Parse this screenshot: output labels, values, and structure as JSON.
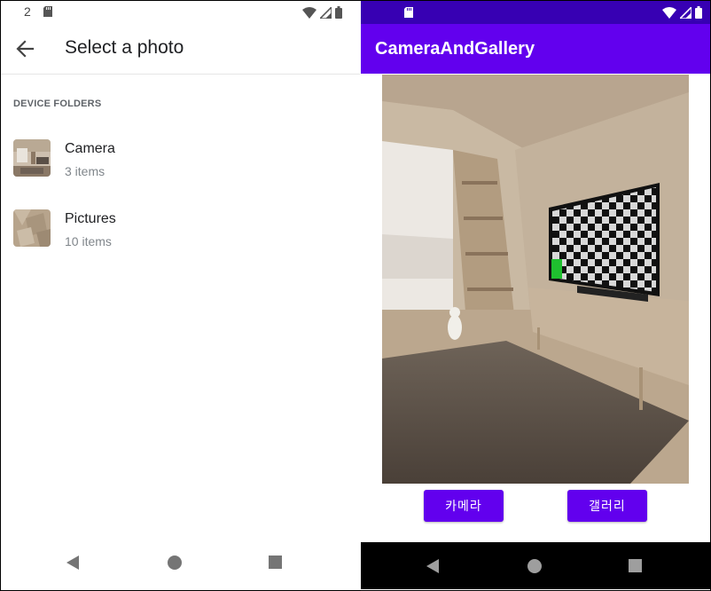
{
  "left_screen": {
    "status_bar": {
      "notification_count": "2"
    },
    "app_bar": {
      "title": "Select a photo"
    },
    "section_label": "DEVICE FOLDERS",
    "folders": [
      {
        "name": "Camera",
        "count": "3 items",
        "icon": "camera-folder-thumbnail"
      },
      {
        "name": "Pictures",
        "count": "10 items",
        "icon": "pictures-folder-thumbnail"
      }
    ]
  },
  "right_screen": {
    "app_bar": {
      "title": "CameraAndGallery"
    },
    "photo": {
      "description_icon": "captured-photo"
    },
    "buttons": {
      "camera": "카메라",
      "gallery": "갤러리"
    }
  },
  "colors": {
    "primary": "#6200ee",
    "status_bar": "#3700b3",
    "nav_bar_dark": "#000000"
  }
}
